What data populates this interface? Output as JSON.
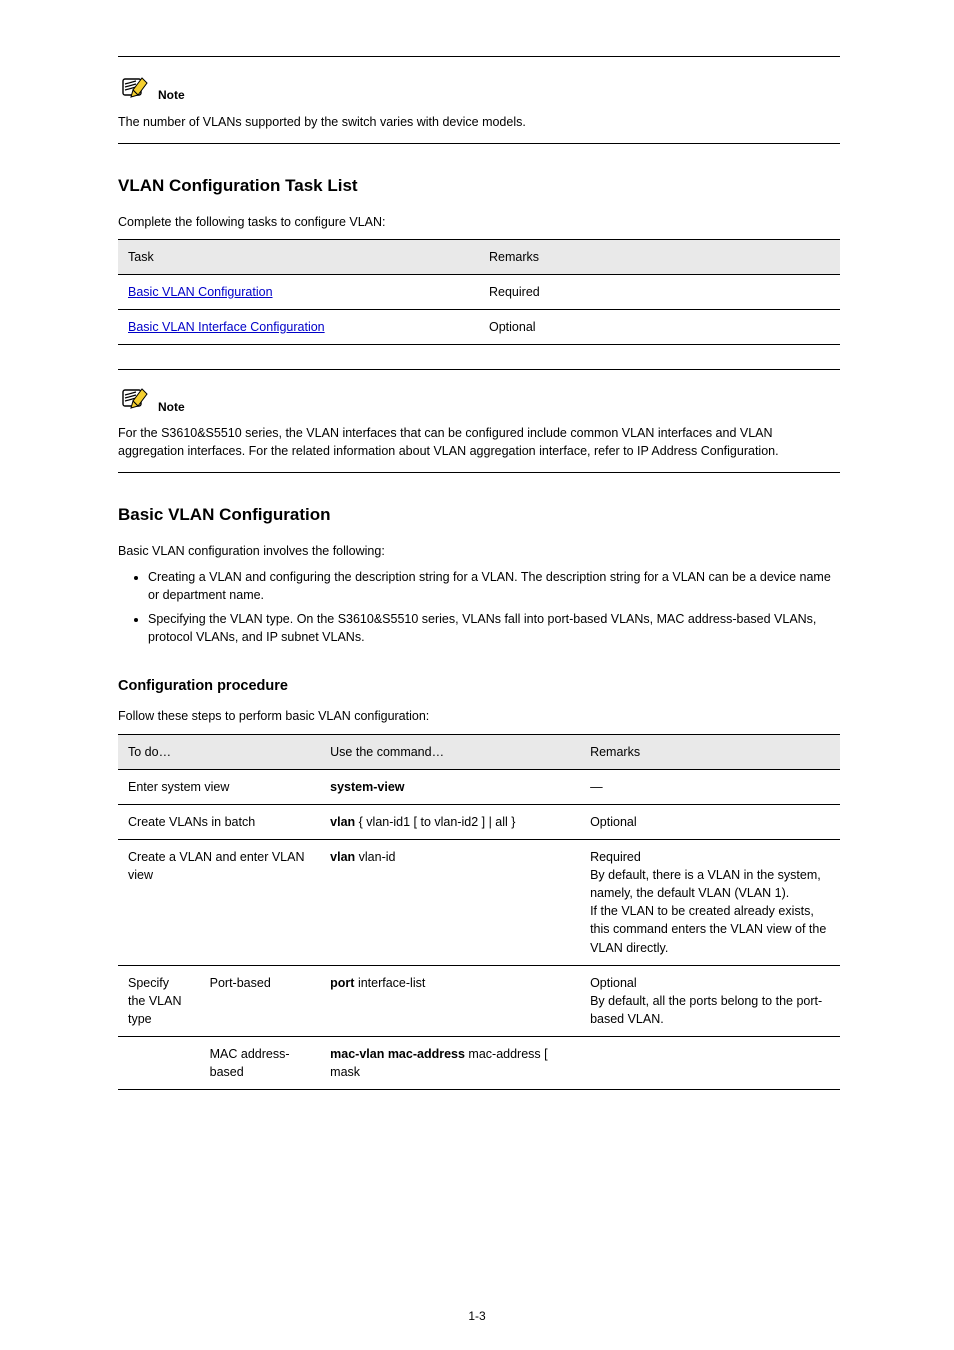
{
  "note1": {
    "label": "Note",
    "body": "The number of VLANs supported by the switch varies with device models."
  },
  "task_list": {
    "section_title": "VLAN Configuration Task List",
    "caption": "Complete the following tasks to configure VLAN:",
    "header_task": "Task",
    "header_remarks": "Remarks",
    "rows": [
      {
        "task": "Basic VLAN Configuration",
        "remarks": "Required"
      },
      {
        "task": "Basic VLAN Interface Configuration",
        "remarks": "Optional"
      }
    ]
  },
  "note2": {
    "label": "Note",
    "body": "For the S3610&S5510 series, the VLAN interfaces that can be configured include common VLAN interfaces and VLAN aggregation interfaces. For the related information about VLAN aggregation interface, refer to IP Address Configuration."
  },
  "basic_vlan": {
    "section_title": "Basic VLAN Configuration",
    "intro": "Basic VLAN configuration involves the following:",
    "bullets": [
      "Creating a VLAN and configuring the description string for a VLAN. The description string for a VLAN can be a device name or department name.",
      "Specifying the VLAN type. On the S3610&S5510 series, VLANs fall into port-based VLANs, MAC address-based VLANs, protocol VLANs, and IP subnet VLANs."
    ]
  },
  "cfg_proc": {
    "heading": "Configuration procedure",
    "caption": "Follow these steps to perform basic VLAN configuration:",
    "headers": [
      "To do…",
      "Use the command…",
      "Remarks"
    ],
    "row1": {
      "todo": "Enter system view",
      "cmd": "system-view",
      "remarks": "—"
    },
    "row2": {
      "todo": "Create VLANs in batch",
      "cmd_prefix": "vlan ",
      "cmd_args": "{ vlan-id1 [ to vlan-id2 ] | all }",
      "remarks": "Optional"
    },
    "row3": {
      "todo": "Create a VLAN and enter VLAN view",
      "cmd_prefix": "vlan ",
      "cmd_args": "vlan-id",
      "remarks_lines": [
        "Required",
        "By default, there is a VLAN in the system, namely, the default VLAN (VLAN 1).",
        "If the VLAN to be created already exists, this command enters the VLAN view of the VLAN directly."
      ]
    },
    "row4": {
      "left_label": "Specify the VLAN type",
      "sub1": {
        "sub_label": "Port-based",
        "cmd_prefix": "port ",
        "cmd_args": "interface-list",
        "remarks": "Optional\nBy default, all the ports belong to the port-based VLAN."
      },
      "sub2": {
        "sub_label": "MAC address-based",
        "cmd_prefix": "mac-vlan mac-address",
        "cmd_args": " mac-address [ mask"
      }
    }
  },
  "page_number": "1-3"
}
